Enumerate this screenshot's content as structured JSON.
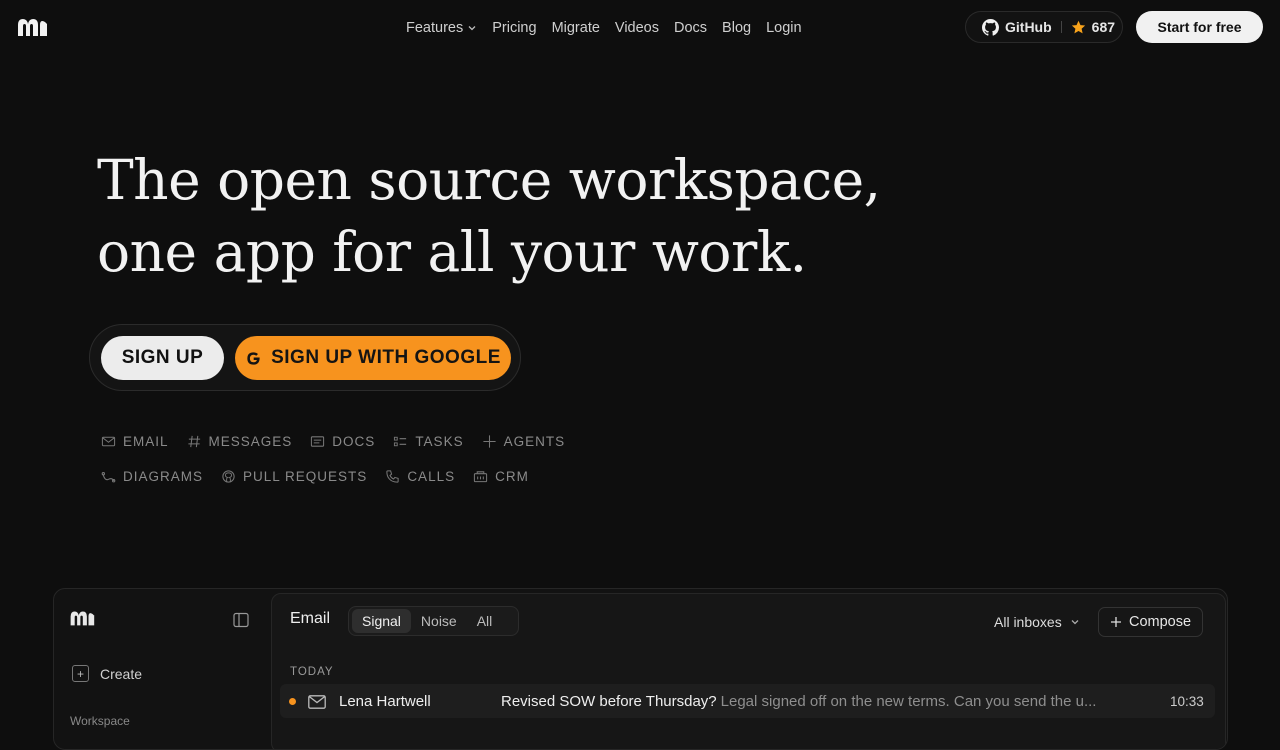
{
  "nav": {
    "links": [
      "Features",
      "Pricing",
      "Migrate",
      "Videos",
      "Docs",
      "Blog",
      "Login"
    ],
    "github_label": "GitHub",
    "github_stars": "687",
    "start_label": "Start for free"
  },
  "hero": {
    "title_line1": "The open source workspace,",
    "title_line2": "one app for all your work.",
    "signup_label": "SIGN UP",
    "google_label": "SIGN UP WITH GOOGLE",
    "features_row1": [
      "EMAIL",
      "MESSAGES",
      "DOCS",
      "TASKS",
      "AGENTS"
    ],
    "features_row2": [
      "DIAGRAMS",
      "PULL REQUESTS",
      "CALLS",
      "CRM"
    ]
  },
  "app": {
    "sidebar": {
      "create_label": "Create",
      "workspace_label": "Workspace"
    },
    "main": {
      "title": "Email",
      "tabs": [
        "Signal",
        "Noise",
        "All"
      ],
      "active_tab": "Signal",
      "inboxes_label": "All inboxes",
      "compose_label": "Compose",
      "section_label": "TODAY",
      "rows": [
        {
          "sender": "Lena Hartwell",
          "subject": "Revised SOW before Thursday?",
          "snippet": "Legal signed off on the new terms. Can you send the u...",
          "time": "10:33",
          "unread_color": "#f7931e"
        }
      ]
    }
  },
  "colors": {
    "accent": "#f7931e",
    "background": "#0e0e0e",
    "star": "#f7a21b"
  }
}
